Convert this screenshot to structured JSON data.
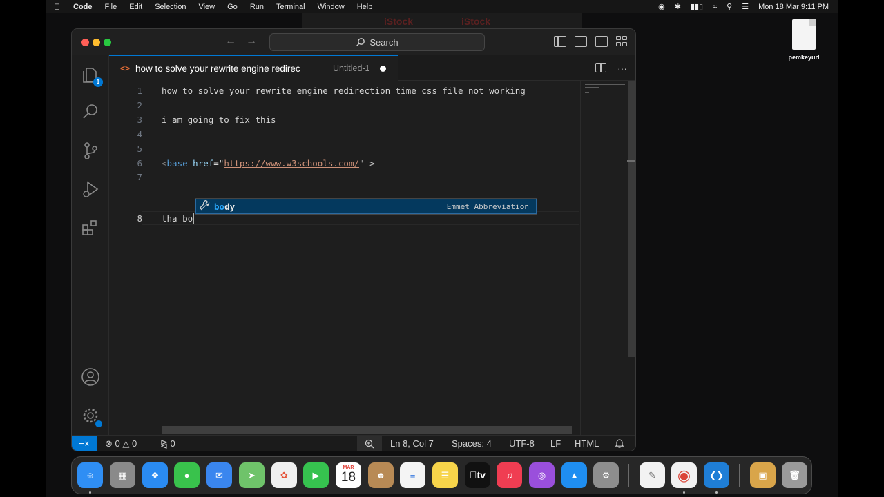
{
  "menubar": {
    "items": [
      "Code",
      "File",
      "Edit",
      "Selection",
      "View",
      "Go",
      "Run",
      "Terminal",
      "Window",
      "Help"
    ],
    "datetime": "Mon 18 Mar  9:11 PM"
  },
  "background": {
    "watermark_1": "iStock",
    "watermark_2": "iStock"
  },
  "desktop": {
    "file_label": "pemkeyurl"
  },
  "titlebar": {
    "search_label": "Search"
  },
  "activity": {
    "explorer_badge": "1"
  },
  "tab": {
    "title": "how to solve your rewrite engine redirec",
    "description": "Untitled-1",
    "more": "···"
  },
  "editor": {
    "line_numbers": [
      "1",
      "2",
      "3",
      "4",
      "5",
      "6",
      "7",
      "8"
    ],
    "lines": {
      "l1": "how to solve your rewrite engine redirection time css file not working",
      "l3": "i am going to fix this",
      "l6_open": "<",
      "l6_tag": "base",
      "l6_attr": " href",
      "l6_eq": "=\"",
      "l6_url": "https://www.w3schools.com/",
      "l6_close": "\" >",
      "l8": "tha bo"
    }
  },
  "suggest": {
    "match": "bo",
    "rest": "dy",
    "detail": "Emmet Abbreviation"
  },
  "statusbar": {
    "errors": "0",
    "warnings": "0",
    "ports": "0",
    "position": "Ln 8, Col 7",
    "spaces": "Spaces: 4",
    "encoding": "UTF-8",
    "eol": "LF",
    "language": "HTML"
  },
  "dock": {
    "calendar_month": "MAR",
    "calendar_day": "18",
    "tv_label": "tv"
  }
}
